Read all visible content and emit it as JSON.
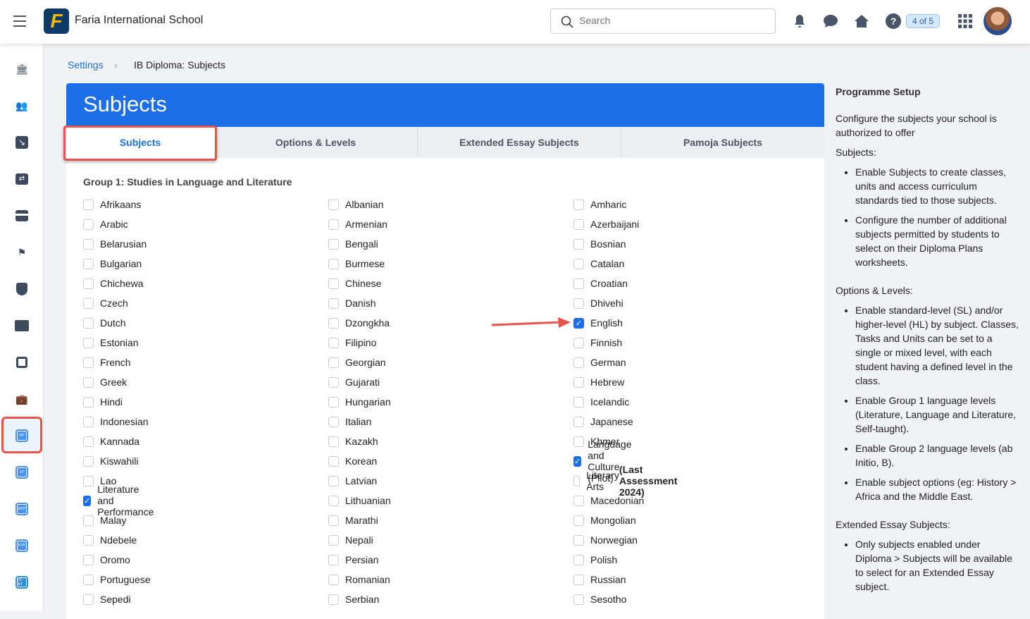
{
  "header": {
    "school": "Faria International School",
    "search_placeholder": "Search",
    "badge": "4 of 5"
  },
  "breadcrumb": {
    "parent": "Settings",
    "current": "IB Diploma: Subjects"
  },
  "page": {
    "title": "Subjects",
    "tabs": [
      "Subjects",
      "Options & Levels",
      "Extended Essay Subjects",
      "Pamoja Subjects"
    ],
    "group_title": "Group 1: Studies in Language and Literature"
  },
  "columns": [
    [
      {
        "label": "Afrikaans"
      },
      {
        "label": "Arabic"
      },
      {
        "label": "Belarusian"
      },
      {
        "label": "Bulgarian"
      },
      {
        "label": "Chichewa"
      },
      {
        "label": "Czech"
      },
      {
        "label": "Dutch"
      },
      {
        "label": "Estonian"
      },
      {
        "label": "French"
      },
      {
        "label": "Greek"
      },
      {
        "label": "Hindi"
      },
      {
        "label": "Indonesian"
      },
      {
        "label": "Kannada"
      },
      {
        "label": "Kiswahili"
      },
      {
        "label": "Lao"
      },
      {
        "label": "Literature and Performance",
        "checked": true
      },
      {
        "label": "Malay"
      },
      {
        "label": "Ndebele"
      },
      {
        "label": "Oromo"
      },
      {
        "label": "Portuguese"
      },
      {
        "label": "Sepedi"
      }
    ],
    [
      {
        "label": "Albanian"
      },
      {
        "label": "Armenian"
      },
      {
        "label": "Bengali"
      },
      {
        "label": "Burmese"
      },
      {
        "label": "Chinese"
      },
      {
        "label": "Danish"
      },
      {
        "label": "Dzongkha"
      },
      {
        "label": "Filipino"
      },
      {
        "label": "Georgian"
      },
      {
        "label": "Gujarati"
      },
      {
        "label": "Hungarian"
      },
      {
        "label": "Italian"
      },
      {
        "label": "Kazakh"
      },
      {
        "label": "Korean"
      },
      {
        "label": "Latvian"
      },
      {
        "label": "Lithuanian"
      },
      {
        "label": "Marathi"
      },
      {
        "label": "Nepali"
      },
      {
        "label": "Persian"
      },
      {
        "label": "Romanian"
      },
      {
        "label": "Serbian"
      }
    ],
    [
      {
        "label": "Amharic"
      },
      {
        "label": "Azerbaijani"
      },
      {
        "label": "Bosnian"
      },
      {
        "label": "Catalan"
      },
      {
        "label": "Croatian"
      },
      {
        "label": "Dhivehi"
      },
      {
        "label": "English",
        "checked": true
      },
      {
        "label": "Finnish"
      },
      {
        "label": "German"
      },
      {
        "label": "Hebrew"
      },
      {
        "label": "Icelandic"
      },
      {
        "label": "Japanese"
      },
      {
        "label": "Khmer"
      },
      {
        "label": "Language and Culture (Pilot)",
        "checked": true
      },
      {
        "label": "Literary Arts ",
        "bold": "(Last Assessment 2024)"
      },
      {
        "label": "Macedonian"
      },
      {
        "label": "Mongolian"
      },
      {
        "label": "Norwegian"
      },
      {
        "label": "Polish"
      },
      {
        "label": "Russian"
      },
      {
        "label": "Sesotho"
      }
    ]
  ],
  "help": {
    "title": "Programme Setup",
    "intro": "Configure the subjects your school is authorized to offer",
    "sections": [
      {
        "heading": "Subjects:",
        "items": [
          "Enable Subjects to create classes, units and access curriculum standards tied to those subjects.",
          "Configure the number of additional subjects permitted by students to select on their Diploma Plans worksheets."
        ]
      },
      {
        "heading": "Options & Levels:",
        "items": [
          "Enable standard-level (SL) and/or higher-level (HL) by subject. Classes, Tasks and Units can be set to a single or mixed level, with each student having a defined level in the class.",
          "Enable Group 1 language levels (Literature, Language and Literature, Self-taught).",
          "Enable Group 2 language levels (ab Initio, B).",
          "Enable subject options (eg: History > Africa and the Middle East."
        ]
      },
      {
        "heading": "Extended Essay Subjects:",
        "items": [
          "Only subjects enabled under Diploma > Subjects will be available to select for an Extended Essay subject."
        ]
      }
    ]
  },
  "sidebar_programmes": [
    "DP",
    "CP",
    "MYP",
    "PYP",
    "ED INT"
  ],
  "colors": {
    "primary": "#1c6fe6",
    "highlight": "#e8534a"
  }
}
